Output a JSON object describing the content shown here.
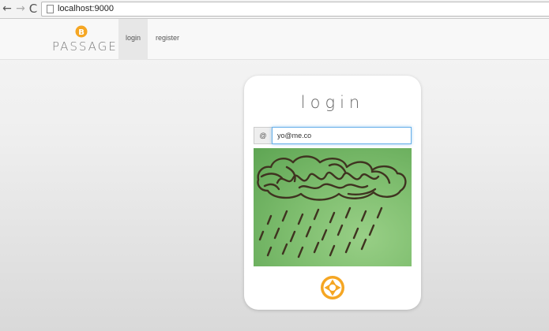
{
  "browser": {
    "back_icon": "←",
    "forward_icon": "→",
    "reload_icon": "C",
    "url": "localhost:9000"
  },
  "navbar": {
    "brand_text": "PASSAGE",
    "items": [
      {
        "label": "login",
        "active": true
      },
      {
        "label": "register",
        "active": false
      }
    ]
  },
  "login": {
    "title": "login",
    "email_addon": "@",
    "email_value": "yo@me.co"
  },
  "icons": {
    "brand": "bitcoin-coin-icon",
    "capture": "camera-shutter-icon"
  },
  "colors": {
    "accent": "#f5a623",
    "focus_border": "#66afe9",
    "camera_green": "#7fbe6f"
  }
}
